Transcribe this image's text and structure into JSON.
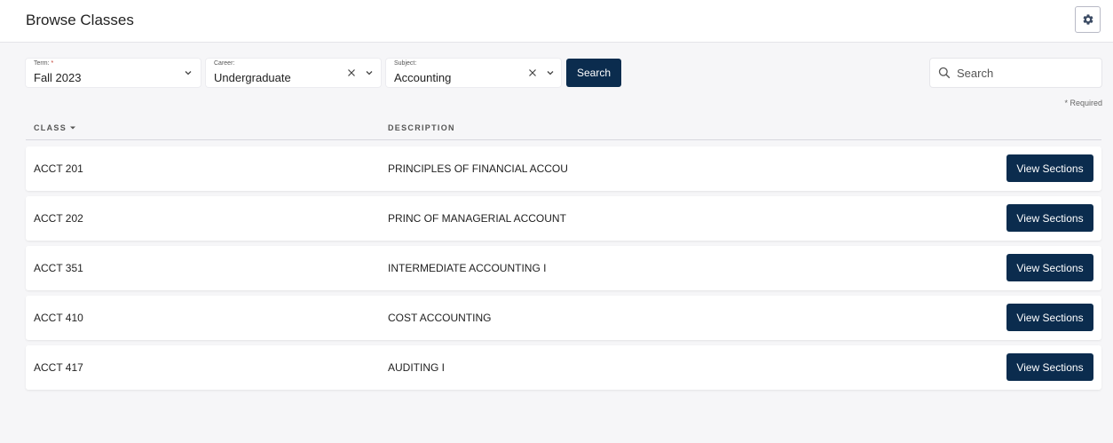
{
  "header": {
    "title": "Browse Classes",
    "settings_icon": "gear-icon"
  },
  "filters": {
    "term": {
      "label": "Term:",
      "required_mark": "*",
      "value": "Fall 2023"
    },
    "career": {
      "label": "Career:",
      "value": "Undergraduate"
    },
    "subject": {
      "label": "Subject:",
      "value": "Accounting"
    },
    "search_button": "Search",
    "search_placeholder": "Search",
    "required_note": "* Required"
  },
  "table": {
    "columns": {
      "class": "CLASS",
      "description": "DESCRIPTION"
    },
    "action_label": "View Sections",
    "rows": [
      {
        "code": "ACCT 201",
        "description": "PRINCIPLES OF FINANCIAL ACCOU"
      },
      {
        "code": "ACCT 202",
        "description": "PRINC OF MANAGERIAL ACCOUNT"
      },
      {
        "code": "ACCT 351",
        "description": "INTERMEDIATE ACCOUNTING I"
      },
      {
        "code": "ACCT 410",
        "description": "COST ACCOUNTING"
      },
      {
        "code": "ACCT 417",
        "description": "AUDITING I"
      }
    ]
  },
  "colors": {
    "primary": "#0b2c4e",
    "background": "#f6f6f8",
    "required": "#c0392b"
  }
}
